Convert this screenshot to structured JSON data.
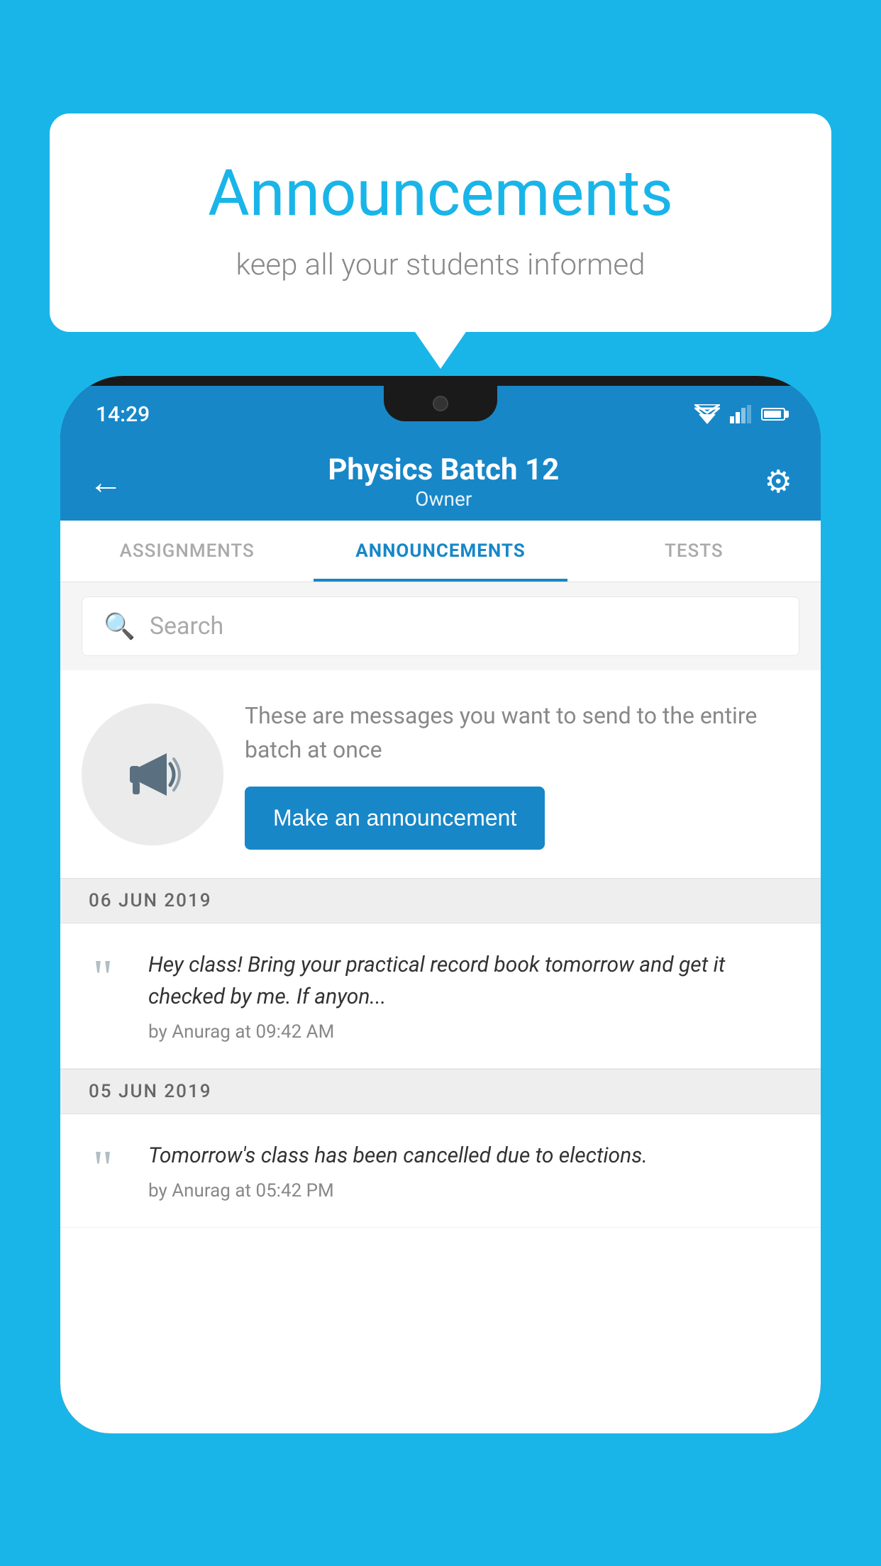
{
  "background_color": "#1ab5e8",
  "bubble": {
    "title": "Announcements",
    "subtitle": "keep all your students informed"
  },
  "phone": {
    "status_bar": {
      "time": "14:29"
    },
    "app_bar": {
      "title": "Physics Batch 12",
      "subtitle": "Owner",
      "back_label": "←",
      "settings_label": "⚙"
    },
    "tabs": [
      {
        "label": "ASSIGNMENTS",
        "active": false
      },
      {
        "label": "ANNOUNCEMENTS",
        "active": true
      },
      {
        "label": "TESTS",
        "active": false
      }
    ],
    "search": {
      "placeholder": "Search"
    },
    "promo": {
      "description": "These are messages you want to send to the entire batch at once",
      "button_label": "Make an announcement"
    },
    "announcements": [
      {
        "date": "06  JUN  2019",
        "text": "Hey class! Bring your practical record book tomorrow and get it checked by me. If anyon...",
        "author": "by Anurag at 09:42 AM"
      },
      {
        "date": "05  JUN  2019",
        "text": "Tomorrow's class has been cancelled due to elections.",
        "author": "by Anurag at 05:42 PM"
      }
    ]
  }
}
